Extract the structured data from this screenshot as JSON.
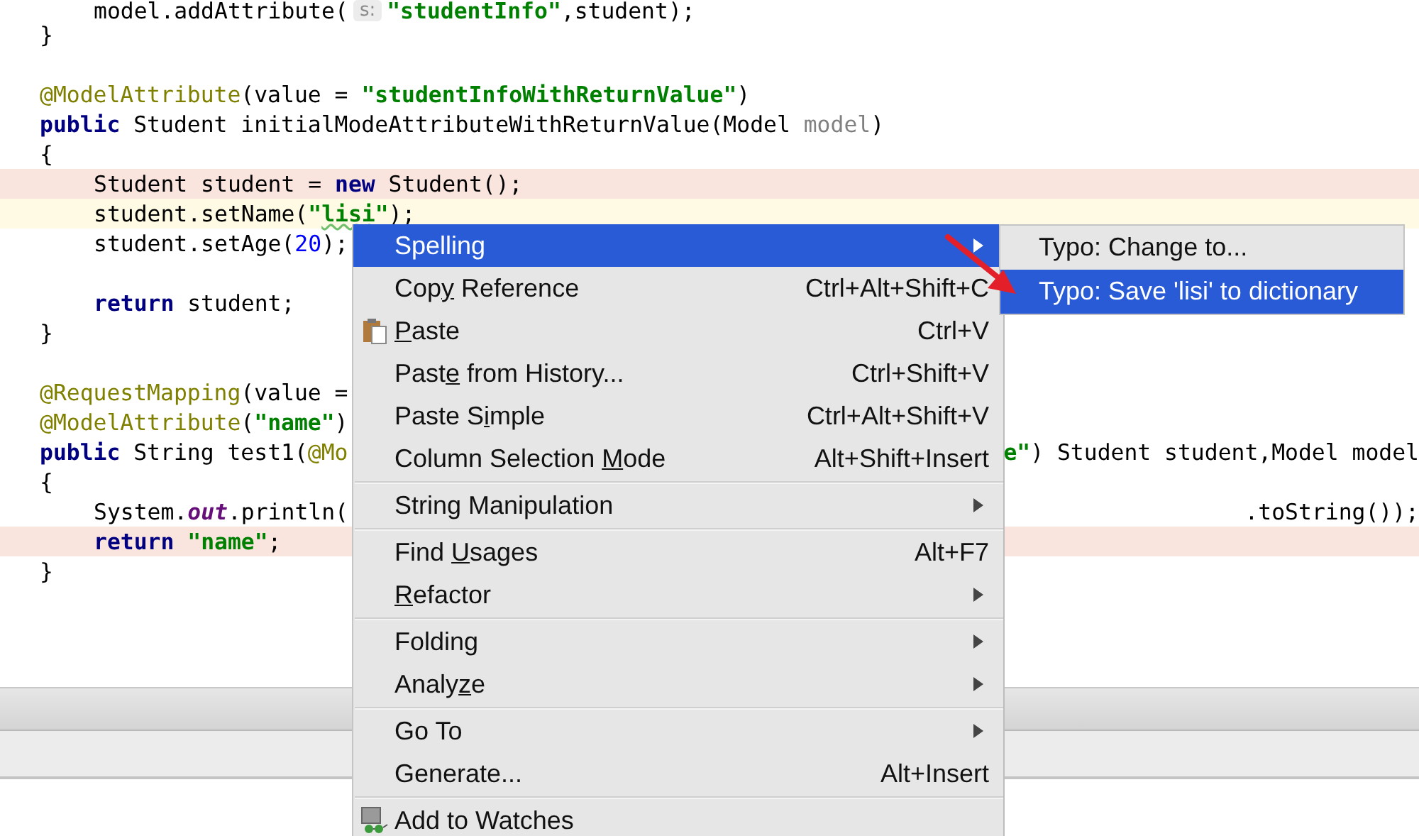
{
  "editor": {
    "lines": [
      {
        "kind": "plain",
        "indent": true,
        "tokens": [
          {
            "kind": "plain",
            "text": "model.addAttribute("
          },
          {
            "kind": "hint",
            "text": "s:"
          },
          {
            "kind": "string",
            "text": "\"studentInfo\""
          },
          {
            "kind": "plain",
            "text": ",student);"
          }
        ]
      },
      {
        "kind": "plain",
        "indent": false,
        "tokens": [
          {
            "kind": "plain",
            "text": "}"
          }
        ]
      },
      {
        "kind": "blank"
      },
      {
        "kind": "plain",
        "indent": false,
        "tokens": [
          {
            "kind": "annotation",
            "text": "@ModelAttribute"
          },
          {
            "kind": "plain",
            "text": "(value = "
          },
          {
            "kind": "string",
            "text": "\"studentInfoWithReturnValue\""
          },
          {
            "kind": "plain",
            "text": ")"
          }
        ]
      },
      {
        "kind": "plain",
        "indent": false,
        "tokens": [
          {
            "kind": "keyword",
            "text": "public"
          },
          {
            "kind": "plain",
            "text": " Student initialModeAttributeWithReturnValue(Model "
          },
          {
            "kind": "unused",
            "text": "model"
          },
          {
            "kind": "plain",
            "text": ")"
          }
        ]
      },
      {
        "kind": "plain",
        "indent": false,
        "tokens": [
          {
            "kind": "plain",
            "text": "{"
          }
        ]
      },
      {
        "kind": "error",
        "indent": true,
        "tokens": [
          {
            "kind": "plain",
            "text": "Student student = "
          },
          {
            "kind": "keyword",
            "text": "new"
          },
          {
            "kind": "plain",
            "text": " Student();"
          }
        ]
      },
      {
        "kind": "current",
        "indent": true,
        "tokens": [
          {
            "kind": "plain",
            "text": "student.setName("
          },
          {
            "kind": "string",
            "text": "\""
          },
          {
            "kind": "typo",
            "text": "lisi"
          },
          {
            "kind": "string",
            "text": "\""
          },
          {
            "kind": "plain",
            "text": ");"
          }
        ]
      },
      {
        "kind": "plain",
        "indent": true,
        "tokens": [
          {
            "kind": "plain",
            "text": "student.setAge("
          },
          {
            "kind": "number",
            "text": "20"
          },
          {
            "kind": "plain",
            "text": ");"
          }
        ]
      },
      {
        "kind": "blank"
      },
      {
        "kind": "plain",
        "indent": true,
        "tokens": [
          {
            "kind": "keyword",
            "text": "return"
          },
          {
            "kind": "plain",
            "text": " student;"
          }
        ]
      },
      {
        "kind": "plain",
        "indent": false,
        "tokens": [
          {
            "kind": "plain",
            "text": "}"
          }
        ]
      },
      {
        "kind": "blank"
      },
      {
        "kind": "plain",
        "indent": false,
        "tokens": [
          {
            "kind": "annotation",
            "text": "@RequestMapping"
          },
          {
            "kind": "plain",
            "text": "(value ="
          }
        ]
      },
      {
        "kind": "plain",
        "indent": false,
        "tokens": [
          {
            "kind": "annotation",
            "text": "@ModelAttribute"
          },
          {
            "kind": "plain",
            "text": "("
          },
          {
            "kind": "string",
            "text": "\"name\""
          },
          {
            "kind": "plain",
            "text": ")"
          }
        ]
      },
      {
        "kind": "plain",
        "indent": false,
        "tokens": [
          {
            "kind": "keyword",
            "text": "public"
          },
          {
            "kind": "plain",
            "text": " String test1("
          },
          {
            "kind": "annotation",
            "text": "@Mo"
          }
        ],
        "after_menu": [
          {
            "kind": "string",
            "text": "e\""
          },
          {
            "kind": "plain",
            "text": ") Student student,Model model"
          }
        ]
      },
      {
        "kind": "plain",
        "indent": false,
        "tokens": [
          {
            "kind": "plain",
            "text": "{"
          }
        ]
      },
      {
        "kind": "plain",
        "indent": true,
        "tokens": [
          {
            "kind": "plain",
            "text": "System."
          },
          {
            "kind": "field",
            "text": "out"
          },
          {
            "kind": "plain",
            "text": ".println("
          }
        ],
        "after_menu": [
          {
            "kind": "plain",
            "text": ".toString());"
          }
        ]
      },
      {
        "kind": "error",
        "indent": true,
        "tokens": [
          {
            "kind": "keyword",
            "text": "return "
          },
          {
            "kind": "string",
            "text": "\"name\""
          },
          {
            "kind": "plain",
            "text": ";"
          }
        ]
      },
      {
        "kind": "plain",
        "indent": false,
        "tokens": [
          {
            "kind": "plain",
            "text": "}"
          }
        ]
      }
    ]
  },
  "context_menu": {
    "groups": [
      [
        {
          "kind": "plain",
          "label": {
            "before": "Spelling"
          },
          "selected": true,
          "submenu": true
        },
        {
          "kind": "plain",
          "label": {
            "before": "Cop",
            "key": "y",
            "after": " Reference"
          },
          "shortcut": "Ctrl+Alt+Shift+C",
          "selected": false,
          "submenu": false
        },
        {
          "kind": "clipboard",
          "label": {
            "key": "P",
            "after": "aste"
          },
          "shortcut": "Ctrl+V",
          "selected": false,
          "submenu": false
        },
        {
          "kind": "plain",
          "label": {
            "before": "Past",
            "key": "e",
            "after": " from History..."
          },
          "shortcut": "Ctrl+Shift+V",
          "selected": false,
          "submenu": false
        },
        {
          "kind": "plain",
          "label": {
            "before": "Paste S",
            "key": "i",
            "after": "mple"
          },
          "shortcut": "Ctrl+Alt+Shift+V",
          "selected": false,
          "submenu": false
        },
        {
          "kind": "plain",
          "label": {
            "before": "Column Selection ",
            "key": "M",
            "after": "ode"
          },
          "shortcut": "Alt+Shift+Insert",
          "selected": false,
          "submenu": false
        }
      ],
      [
        {
          "kind": "plain",
          "label": {
            "before": "String Manipulation"
          },
          "selected": false,
          "submenu": true
        }
      ],
      [
        {
          "kind": "plain",
          "label": {
            "before": "Find ",
            "key": "U",
            "after": "sages"
          },
          "shortcut": "Alt+F7",
          "selected": false,
          "submenu": false
        },
        {
          "kind": "plain",
          "label": {
            "key": "R",
            "after": "efactor"
          },
          "selected": false,
          "submenu": true
        }
      ],
      [
        {
          "kind": "plain",
          "label": {
            "before": "Folding"
          },
          "selected": false,
          "submenu": true
        },
        {
          "kind": "plain",
          "label": {
            "before": "Analy",
            "key": "z",
            "after": "e"
          },
          "selected": false,
          "submenu": true
        }
      ],
      [
        {
          "kind": "plain",
          "label": {
            "before": "Go To"
          },
          "selected": false,
          "submenu": true
        },
        {
          "kind": "plain",
          "label": {
            "before": "Generate..."
          },
          "shortcut": "Alt+Insert",
          "selected": false,
          "submenu": false
        }
      ],
      [
        {
          "kind": "glasses",
          "label": {
            "before": "Add to Watches"
          },
          "selected": false,
          "submenu": false
        }
      ]
    ]
  },
  "submenu": {
    "items": [
      {
        "label": "Typo: Change to...",
        "selected": false
      },
      {
        "label": "Typo: Save 'lisi' to dictionary",
        "selected": true
      }
    ]
  }
}
